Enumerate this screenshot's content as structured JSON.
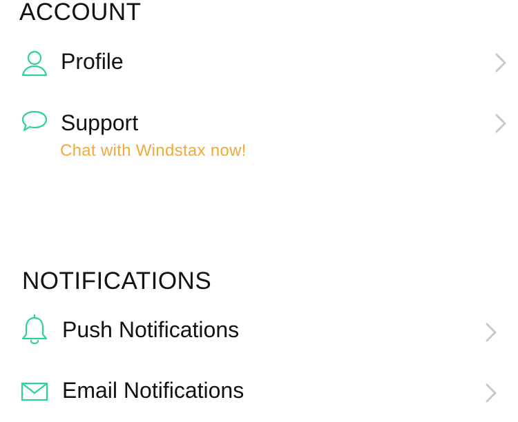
{
  "colors": {
    "accent": "#2ecf9a",
    "highlight": "#f2a93b",
    "chevron": "#c7c7cc",
    "text": "#111111"
  },
  "account": {
    "title": "ACCOUNT",
    "items": [
      {
        "label": "Profile",
        "icon": "person-icon"
      },
      {
        "label": "Support",
        "icon": "chat-bubble-icon",
        "sublabel": "Chat with Windstax now!"
      }
    ]
  },
  "notifications": {
    "title": "NOTIFICATIONS",
    "items": [
      {
        "label": "Push Notifications",
        "icon": "bell-icon"
      },
      {
        "label": "Email Notifications",
        "icon": "envelope-icon"
      }
    ]
  }
}
